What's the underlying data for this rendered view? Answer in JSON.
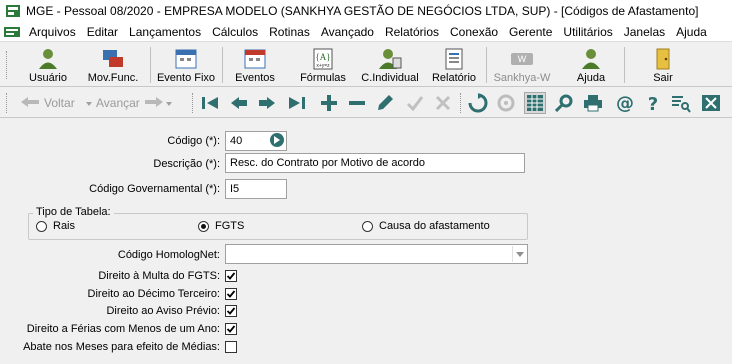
{
  "window": {
    "title": "MGE - Pessoal 08/2020 - EMPRESA MODELO (SANKHYA GESTÃO DE NEGÓCIOS LTDA, SUP) - [Códigos de Afastamento]"
  },
  "menu": {
    "items": [
      "Arquivos",
      "Editar",
      "Lançamentos",
      "Cálculos",
      "Rotinas",
      "Avançado",
      "Relatórios",
      "Conexão",
      "Gerente",
      "Utilitários",
      "Janelas",
      "Ajuda"
    ]
  },
  "toolbar": {
    "buttons": {
      "usuario": "Usuário",
      "movfunc": "Mov.Func.",
      "eventofixo": "Evento Fixo",
      "eventos": "Eventos",
      "formulas": "Fórmulas",
      "cindividual": "C.Individual",
      "relatorio": "Relatório",
      "sankhyaw": "Sankhya-W",
      "ajuda": "Ajuda",
      "sair": "Sair"
    }
  },
  "navbar": {
    "voltar": "Voltar",
    "avancar": "Avançar"
  },
  "form": {
    "codigo": {
      "label": "Código (*):",
      "value": "40"
    },
    "descricao": {
      "label": "Descrição (*):",
      "value": "Resc. do Contrato por Motivo de acordo"
    },
    "codigo_gov": {
      "label": "Código Governamental (*):",
      "value": "I5"
    },
    "tipo_tabela": {
      "title": "Tipo de Tabela:",
      "options": [
        "Rais",
        "FGTS",
        "Causa do afastamento"
      ],
      "selected": "FGTS"
    },
    "homolognet": {
      "label": "Código HomologNet:",
      "value": ""
    },
    "checks": [
      {
        "label": "Direito à Multa do FGTS:",
        "checked": true
      },
      {
        "label": "Direito ao Décimo Terceiro:",
        "checked": true
      },
      {
        "label": "Direito ao Aviso Prévio:",
        "checked": true
      },
      {
        "label": "Direito a Férias com Menos de um Ano:",
        "checked": true
      },
      {
        "label": "Abate nos Meses para efeito de Médias:",
        "checked": false
      }
    ]
  },
  "colors": {
    "nav_green": "#2f6f6f",
    "accent_blue": "#1f5fbf"
  }
}
